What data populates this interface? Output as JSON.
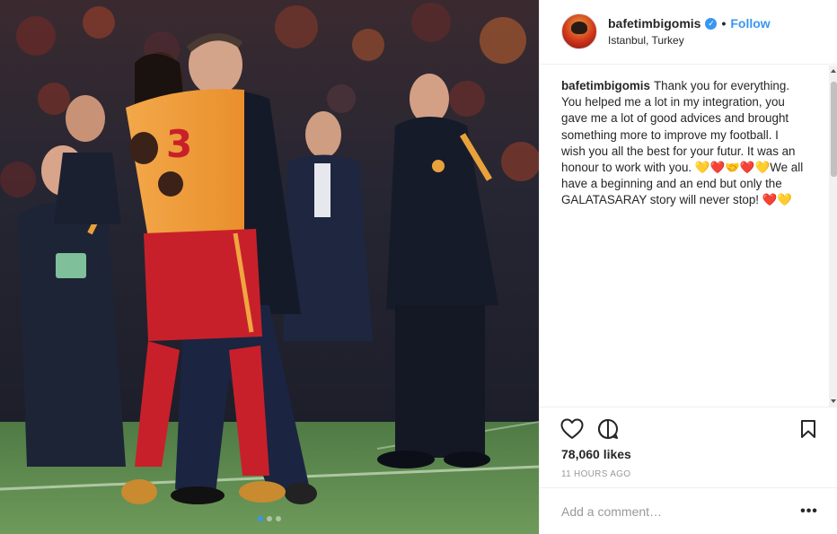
{
  "post": {
    "username": "bafetimbigomis",
    "follow_label": "Follow",
    "separator": "•",
    "location": "Istanbul, Turkey",
    "caption_user": "bafetimbigomis",
    "caption_text": "Thank you for everything. You helped me a lot in my integration, you gave me a lot of good advices and brought something more to improve my football. I wish you all the best for your futur. It was an honour to work with you. 💛❤️🤝❤️💛We all have a beginning and an end but only the GALATASARAY story will never stop! ❤️💛",
    "likes": "78,060 likes",
    "time_ago": "11 HOURS AGO",
    "comment_placeholder": "Add a comment…",
    "more_label": "•••",
    "carousel_count": 3,
    "carousel_active": 1
  },
  "icons": {
    "verified": "verified-badge-icon",
    "like": "heart-icon",
    "comment": "comment-bubble-icon",
    "save": "bookmark-icon",
    "more": "more-options-icon"
  },
  "colors": {
    "accent": "#3897f0",
    "team_red": "#c8202a",
    "team_orange": "#f0a640"
  }
}
